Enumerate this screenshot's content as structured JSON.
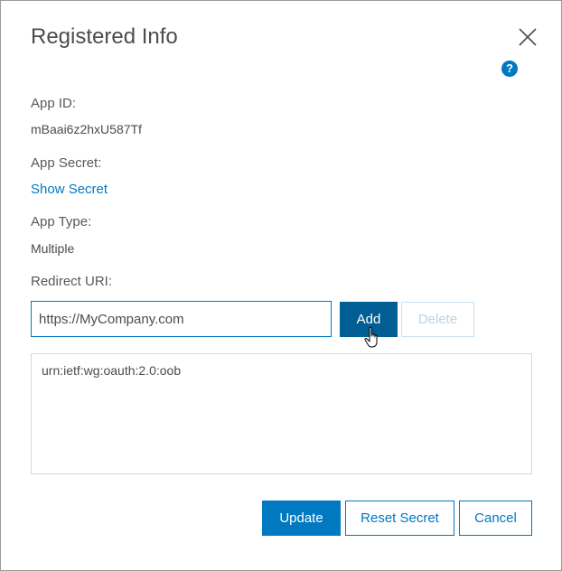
{
  "dialog": {
    "title": "Registered Info",
    "help_symbol": "?",
    "close_icon": "close-icon",
    "help_icon": "question-circle-icon"
  },
  "fields": {
    "app_id_label": "App ID:",
    "app_id_value": "mBaai6z2hxU587Tf",
    "app_secret_label": "App Secret:",
    "show_secret_link": "Show Secret",
    "app_type_label": "App Type:",
    "app_type_value": "Multiple",
    "redirect_uri_label": "Redirect URI:"
  },
  "redirect": {
    "input_value": "https://MyCompany.com",
    "add_label": "Add",
    "delete_label": "Delete",
    "uris": [
      "urn:ietf:wg:oauth:2.0:oob"
    ]
  },
  "footer": {
    "update_label": "Update",
    "reset_secret_label": "Reset Secret",
    "cancel_label": "Cancel"
  },
  "colors": {
    "accent": "#0079c1",
    "accent_pressed": "#005e95",
    "text": "#4c4c4c",
    "border": "#d8d8d8"
  }
}
